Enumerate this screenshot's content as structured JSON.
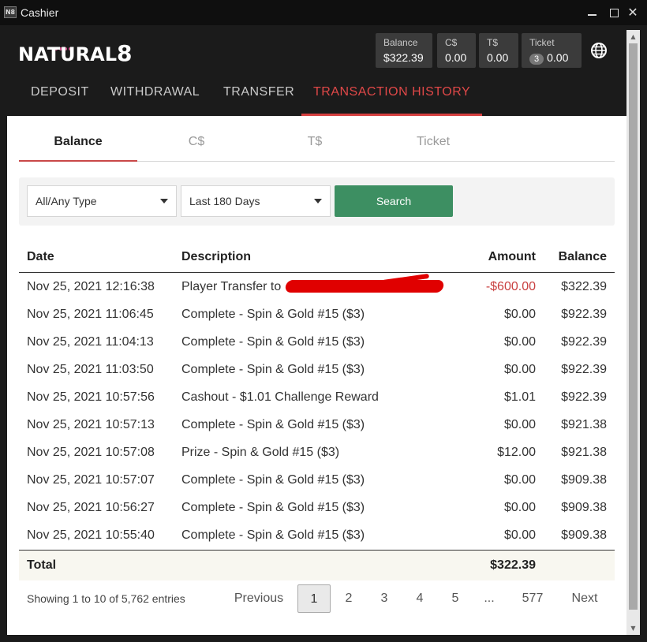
{
  "window": {
    "title": "Cashier",
    "icon_text": "N8"
  },
  "header": {
    "logo_text": "NATURAL",
    "logo_suffix": "8",
    "wallets": {
      "balance": {
        "label": "Balance",
        "value": "$322.39"
      },
      "cs": {
        "label": "C$",
        "value": "0.00"
      },
      "ts": {
        "label": "T$",
        "value": "0.00"
      },
      "ticket": {
        "label": "Ticket",
        "count": "3",
        "value": "0.00"
      }
    },
    "globe_icon": "globe-icon",
    "nav": [
      "DEPOSIT",
      "WITHDRAWAL",
      "TRANSFER",
      "TRANSACTION HISTORY"
    ],
    "active_nav": "TRANSACTION HISTORY"
  },
  "subtabs": [
    "Balance",
    "C$",
    "T$",
    "Ticket"
  ],
  "active_subtab": "Balance",
  "filters": {
    "type": "All/Any Type",
    "range": "Last 180 Days",
    "search_label": "Search"
  },
  "table": {
    "headers": {
      "date": "Date",
      "description": "Description",
      "amount": "Amount",
      "balance": "Balance"
    },
    "rows": [
      {
        "date": "Nov 25, 2021 12:16:38",
        "description": "Player Transfer to",
        "amount": "-$600.00",
        "balance": "$322.39"
      },
      {
        "date": "Nov 25, 2021 11:06:45",
        "description": "Complete - Spin & Gold #15 ($3)",
        "amount": "$0.00",
        "balance": "$922.39"
      },
      {
        "date": "Nov 25, 2021 11:04:13",
        "description": "Complete - Spin & Gold #15 ($3)",
        "amount": "$0.00",
        "balance": "$922.39"
      },
      {
        "date": "Nov 25, 2021 11:03:50",
        "description": "Complete - Spin & Gold #15 ($3)",
        "amount": "$0.00",
        "balance": "$922.39"
      },
      {
        "date": "Nov 25, 2021 10:57:56",
        "description": "Cashout - $1.01 Challenge Reward",
        "amount": "$1.01",
        "balance": "$922.39"
      },
      {
        "date": "Nov 25, 2021 10:57:13",
        "description": "Complete - Spin & Gold #15 ($3)",
        "amount": "$0.00",
        "balance": "$921.38"
      },
      {
        "date": "Nov 25, 2021 10:57:08",
        "description": "Prize - Spin & Gold #15 ($3)",
        "amount": "$12.00",
        "balance": "$921.38"
      },
      {
        "date": "Nov 25, 2021 10:57:07",
        "description": "Complete - Spin & Gold #15 ($3)",
        "amount": "$0.00",
        "balance": "$909.38"
      },
      {
        "date": "Nov 25, 2021 10:56:27",
        "description": "Complete - Spin & Gold #15 ($3)",
        "amount": "$0.00",
        "balance": "$909.38"
      },
      {
        "date": "Nov 25, 2021 10:55:40",
        "description": "Complete - Spin & Gold #15 ($3)",
        "amount": "$0.00",
        "balance": "$909.38"
      }
    ],
    "total_label": "Total",
    "total_amount": "$322.39"
  },
  "pagination": {
    "showing": "Showing 1 to 10 of 5,762 entries",
    "previous": "Previous",
    "pages": [
      "1",
      "2",
      "3",
      "4",
      "5",
      "...",
      "577"
    ],
    "current": "1",
    "next": "Next"
  },
  "colors": {
    "accent_red": "#d54040",
    "search_green": "#3d8f62",
    "negative": "#c94040"
  }
}
